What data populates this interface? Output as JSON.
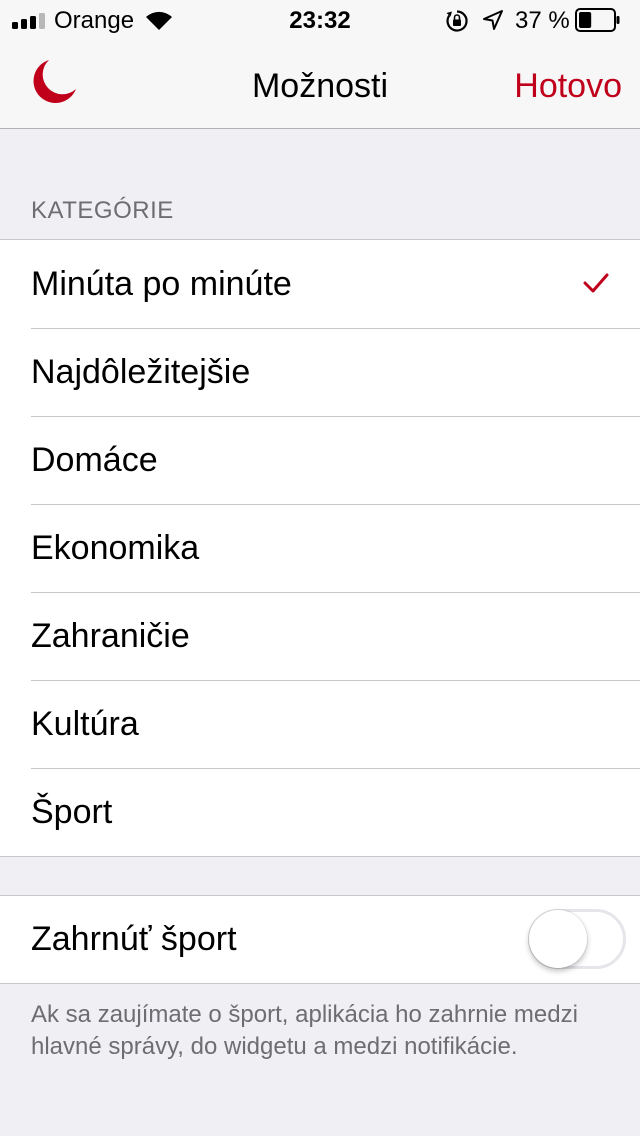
{
  "status_bar": {
    "carrier": "Orange",
    "time": "23:32",
    "battery_percent": "37 %",
    "battery_level": 0.37,
    "signal_bars_filled": 3,
    "signal_bars_total": 4,
    "icons": [
      "signal-icon",
      "wifi-icon",
      "rotation-lock-icon",
      "location-arrow-icon",
      "battery-icon"
    ]
  },
  "nav": {
    "title": "Možnosti",
    "done_label": "Hotovo",
    "logo_icon": "moon-icon"
  },
  "colors": {
    "accent": "#c0001b",
    "background": "#efeff4",
    "secondary_text": "#6d6d72"
  },
  "categories": {
    "header": "KATEGÓRIE",
    "items": [
      {
        "label": "Minúta po minúte",
        "selected": true
      },
      {
        "label": "Najdôležitejšie",
        "selected": false
      },
      {
        "label": "Domáce",
        "selected": false
      },
      {
        "label": "Ekonomika",
        "selected": false
      },
      {
        "label": "Zahraničie",
        "selected": false
      },
      {
        "label": "Kultúra",
        "selected": false
      },
      {
        "label": "Šport",
        "selected": false
      }
    ]
  },
  "sport_toggle": {
    "label": "Zahrnúť šport",
    "enabled": false,
    "note": "Ak sa zaujímate o šport, aplikácia ho zahrnie medzi hlavné správy, do widgetu a medzi notifikácie."
  }
}
